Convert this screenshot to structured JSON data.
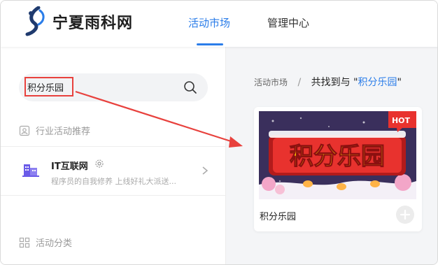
{
  "header": {
    "site_name": "宁夏雨科网",
    "nav": [
      {
        "label": "活动市场",
        "active": true
      },
      {
        "label": "管理中心",
        "active": false
      }
    ]
  },
  "sidebar": {
    "search_value": "积分乐园",
    "recommend_title": "行业活动推荐",
    "org": {
      "name": "IT互联网",
      "description": "程序员的自我修养   上线好礼大派送..."
    },
    "category_title": "活动分类"
  },
  "main": {
    "breadcrumb": {
      "root": "活动市场",
      "separator": "/",
      "prefix": "共找到与 \"",
      "keyword": "积分乐园",
      "suffix": "\" "
    },
    "card": {
      "banner_text": "积分乐园",
      "hot_badge": "HOT",
      "title": "积分乐园"
    }
  },
  "colors": {
    "accent": "#2b7de9",
    "highlight": "#e8413d",
    "banner_bg": "#3a2f5c",
    "banner_sign": "#e8322e",
    "banner_text": "#ffd400"
  },
  "icons": [
    "logo-icon",
    "search-icon",
    "recommend-icon",
    "building-icon",
    "gear-icon",
    "chevron-right-icon",
    "category-grid-icon",
    "add-icon",
    "hot-badge"
  ]
}
